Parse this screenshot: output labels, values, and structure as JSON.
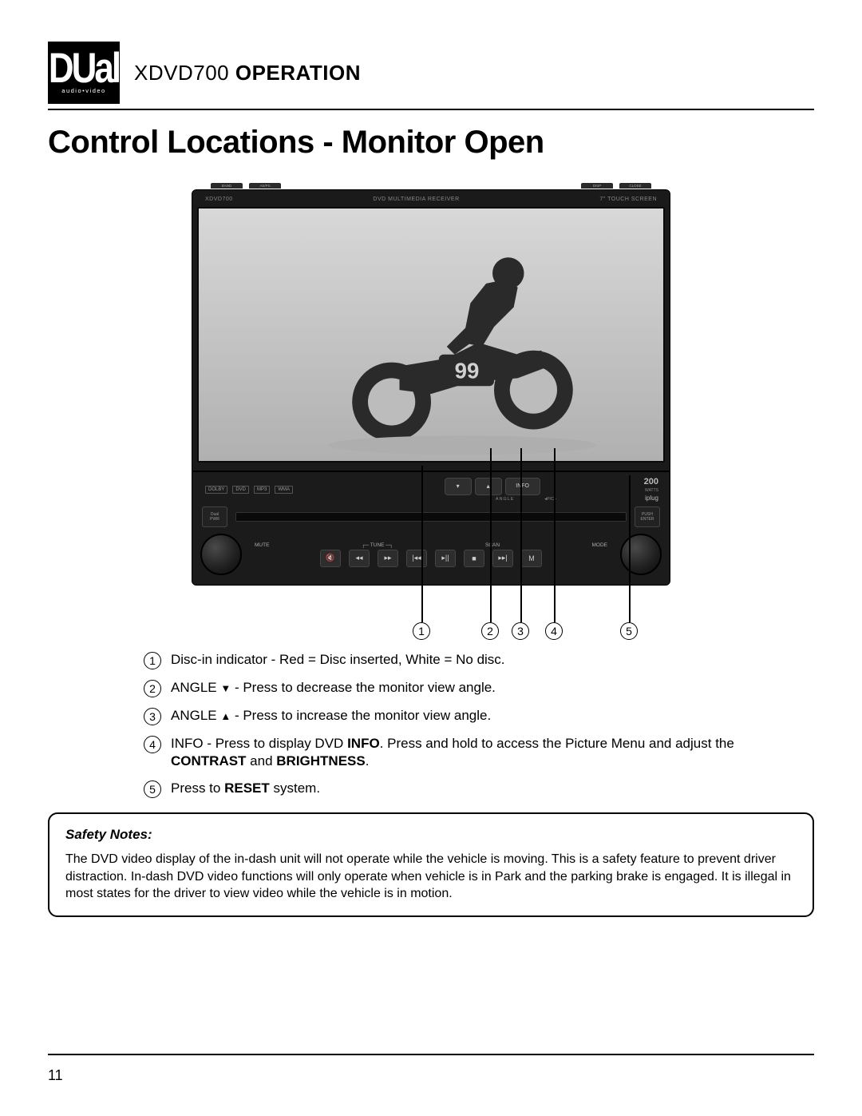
{
  "logo": {
    "brand": "DUal",
    "tagline": "audio•video"
  },
  "header": {
    "model": "XDVD700",
    "section": "OPERATION"
  },
  "section_title": "Control Locations - Monitor Open",
  "device": {
    "top_tabs_left": [
      "BAND",
      "AS/PS"
    ],
    "top_tabs_right": [
      "DISP",
      "CLOSE"
    ],
    "model_label": "XDVD700",
    "receiver_label": "DVD MULTIMEDIA RECEIVER",
    "screen_label": "7\" TOUCH SCREEN",
    "badges": [
      "DOLBY",
      "DVD",
      "MP3",
      "WMA"
    ],
    "watts": "200",
    "watts_unit": "WATTS",
    "iplug": "iplug",
    "angle_down": "▾",
    "angle_up": "▴",
    "info_btn": "INFO",
    "angle_label": "ANGLE",
    "pc_label": "◂P/C▸",
    "left_slot": "Dual",
    "left_slot_sub": "PWR",
    "right_slot_top": "PUSH",
    "right_slot_sub": "ENTER",
    "ctrl_labels": {
      "mute": "MUTE",
      "tune": "TUNE",
      "scan": "SCAN",
      "mode": "MODE"
    },
    "ctrl_btns": [
      "🔇",
      "◂◂",
      "▸▸",
      "|◂◂",
      "▸||",
      "■",
      "▸▸|",
      "M"
    ]
  },
  "callouts": {
    "nums": [
      "1",
      "2",
      "3",
      "4",
      "5"
    ]
  },
  "descriptions": [
    {
      "n": "1",
      "text_before": "Disc-in indicator - Red = Disc inserted, White = No disc.",
      "bold_parts": []
    },
    {
      "n": "2",
      "text_html": "ANGLE <span class='tri-down'></span> - Press to decrease the monitor view angle."
    },
    {
      "n": "3",
      "text_html": "ANGLE <span class='tri-up'></span> - Press to increase the monitor view angle."
    },
    {
      "n": "4",
      "text_html": "INFO - Press to display DVD <b>INFO</b>. Press and hold to access the Picture Menu and adjust the <b>CONTRAST</b> and <b>BRIGHTNESS</b>."
    },
    {
      "n": "5",
      "text_html": "Press to <b>RESET</b> system."
    }
  ],
  "safety": {
    "title": "Safety Notes:",
    "body": "The DVD video display of the in-dash unit will not operate while the vehicle is moving. This is a safety feature to prevent driver distraction. In-dash DVD video functions will only operate when vehicle is in Park and the parking brake is engaged. It is illegal in most states for the driver to view video while the vehicle is in motion."
  },
  "page_number": "11"
}
